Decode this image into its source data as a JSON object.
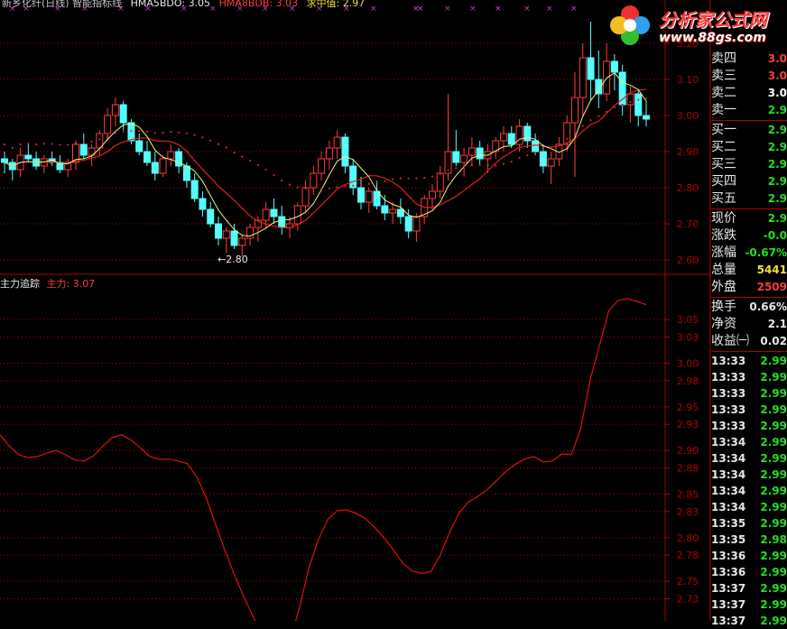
{
  "header": {
    "title": "新乡化纤(日线) 智能指标线",
    "ma1": "HMA5BDO: 3.05",
    "ma2": "HMA8BDB: 3.03",
    "ma3": "求中值: 2.97"
  },
  "indicator": {
    "name": "主力追踪",
    "value_label": "主力: 3.07"
  },
  "price_axis": [
    "3.20",
    "3.10",
    "3.00",
    "2.90",
    "2.80",
    "2.70",
    "2.60"
  ],
  "indicator_axis": [
    "3.05",
    "3.03",
    "3.00",
    "2.98",
    "2.95",
    "2.93",
    "2.90",
    "2.88",
    "2.85",
    "2.83",
    "2.80",
    "2.78",
    "2.75",
    "2.73"
  ],
  "low_marker": "←2.80",
  "quote": [
    {
      "label": "卖四",
      "value": "3.0",
      "color": "#ff3b3b"
    },
    {
      "label": "卖三",
      "value": "3.0",
      "color": "#ff3b3b"
    },
    {
      "label": "卖二",
      "value": "3.0",
      "color": "#ffffff"
    },
    {
      "label": "卖一",
      "value": "2.9",
      "color": "#20e020"
    },
    {
      "label": "买一",
      "value": "2.9",
      "color": "#20e020"
    },
    {
      "label": "买二",
      "value": "2.9",
      "color": "#20e020"
    },
    {
      "label": "买三",
      "value": "2.9",
      "color": "#20e020"
    },
    {
      "label": "买四",
      "value": "2.9",
      "color": "#20e020"
    },
    {
      "label": "买五",
      "value": "2.9",
      "color": "#20e020"
    },
    {
      "label": "现价",
      "value": "2.9",
      "color": "#20e020"
    },
    {
      "label": "涨跌",
      "value": "-0.0",
      "color": "#20e020"
    },
    {
      "label": "涨幅",
      "value": "-0.67%",
      "color": "#20e020"
    },
    {
      "label": "总量",
      "value": "5441",
      "color": "#f0e040"
    },
    {
      "label": "外盘",
      "value": "2509",
      "color": "#ff3b3b"
    },
    {
      "label": "换手",
      "value": "0.66%",
      "color": "#e8e8e8"
    },
    {
      "label": "净资",
      "value": "2.1",
      "color": "#e8e8e8"
    },
    {
      "label": "收益㈠",
      "value": "0.02",
      "color": "#e8e8e8"
    }
  ],
  "ticks": [
    {
      "time": "13:33",
      "price": "2.99"
    },
    {
      "time": "13:33",
      "price": "2.99"
    },
    {
      "time": "13:33",
      "price": "2.99"
    },
    {
      "time": "13:33",
      "price": "2.99"
    },
    {
      "time": "13:33",
      "price": "2.99"
    },
    {
      "time": "13:34",
      "price": "2.99"
    },
    {
      "time": "13:34",
      "price": "2.99"
    },
    {
      "time": "13:34",
      "price": "2.99"
    },
    {
      "time": "13:34",
      "price": "2.99"
    },
    {
      "time": "13:34",
      "price": "2.99"
    },
    {
      "time": "13:35",
      "price": "2.99"
    },
    {
      "time": "13:35",
      "price": "2.98"
    },
    {
      "time": "13:36",
      "price": "2.99"
    },
    {
      "time": "13:36",
      "price": "2.99"
    },
    {
      "time": "13:37",
      "price": "2.99"
    },
    {
      "time": "13:37",
      "price": "2.99"
    },
    {
      "time": "13:37",
      "price": "2.99"
    }
  ],
  "logo": {
    "name": "分析家公式网",
    "url_text": "www.88gs.com"
  },
  "colors": {
    "up": "#ff3b3b",
    "down": "#54ffff",
    "indicator_line": "#e01010",
    "grid": "#b00000",
    "ma_yellow": "#f0f080",
    "dotted": "#e02030"
  },
  "chart_data": {
    "type": "candlestick",
    "price_ylim": [
      2.57,
      3.25
    ],
    "indicator_ylim": [
      2.715,
      3.075
    ],
    "candles": [
      [
        2.88,
        2.9,
        2.84,
        2.87
      ],
      [
        2.87,
        2.88,
        2.82,
        2.85
      ],
      [
        2.85,
        2.91,
        2.83,
        2.89
      ],
      [
        2.89,
        2.92,
        2.87,
        2.88
      ],
      [
        2.88,
        2.9,
        2.85,
        2.86
      ],
      [
        2.86,
        2.89,
        2.84,
        2.88
      ],
      [
        2.88,
        2.9,
        2.86,
        2.87
      ],
      [
        2.87,
        2.89,
        2.84,
        2.85
      ],
      [
        2.85,
        2.88,
        2.83,
        2.87
      ],
      [
        2.87,
        2.93,
        2.85,
        2.92
      ],
      [
        2.92,
        2.95,
        2.88,
        2.89
      ],
      [
        2.89,
        2.92,
        2.86,
        2.91
      ],
      [
        2.91,
        2.96,
        2.89,
        2.95
      ],
      [
        2.95,
        3.02,
        2.93,
        3.0
      ],
      [
        3.0,
        3.05,
        2.97,
        3.03
      ],
      [
        3.03,
        3.04,
        2.96,
        2.98
      ],
      [
        2.98,
        2.99,
        2.92,
        2.93
      ],
      [
        2.93,
        2.95,
        2.89,
        2.9
      ],
      [
        2.9,
        2.93,
        2.86,
        2.87
      ],
      [
        2.87,
        2.9,
        2.82,
        2.84
      ],
      [
        2.84,
        2.89,
        2.83,
        2.88
      ],
      [
        2.88,
        2.92,
        2.86,
        2.9
      ],
      [
        2.9,
        2.91,
        2.84,
        2.86
      ],
      [
        2.86,
        2.87,
        2.8,
        2.82
      ],
      [
        2.82,
        2.84,
        2.76,
        2.77
      ],
      [
        2.77,
        2.79,
        2.72,
        2.74
      ],
      [
        2.74,
        2.76,
        2.69,
        2.7
      ],
      [
        2.7,
        2.72,
        2.64,
        2.66
      ],
      [
        2.66,
        2.69,
        2.62,
        2.68
      ],
      [
        2.68,
        2.7,
        2.63,
        2.64
      ],
      [
        2.64,
        2.67,
        2.61,
        2.66
      ],
      [
        2.66,
        2.7,
        2.64,
        2.69
      ],
      [
        2.69,
        2.72,
        2.65,
        2.71
      ],
      [
        2.71,
        2.76,
        2.69,
        2.74
      ],
      [
        2.74,
        2.77,
        2.7,
        2.72
      ],
      [
        2.72,
        2.75,
        2.67,
        2.69
      ],
      [
        2.69,
        2.72,
        2.66,
        2.7
      ],
      [
        2.7,
        2.76,
        2.68,
        2.75
      ],
      [
        2.75,
        2.82,
        2.73,
        2.8
      ],
      [
        2.8,
        2.86,
        2.78,
        2.84
      ],
      [
        2.84,
        2.9,
        2.82,
        2.88
      ],
      [
        2.88,
        2.93,
        2.85,
        2.91
      ],
      [
        2.91,
        2.96,
        2.88,
        2.94
      ],
      [
        2.94,
        2.95,
        2.84,
        2.86
      ],
      [
        2.86,
        2.88,
        2.78,
        2.8
      ],
      [
        2.8,
        2.83,
        2.74,
        2.76
      ],
      [
        2.76,
        2.8,
        2.73,
        2.79
      ],
      [
        2.79,
        2.82,
        2.74,
        2.75
      ],
      [
        2.75,
        2.78,
        2.71,
        2.73
      ],
      [
        2.73,
        2.76,
        2.7,
        2.74
      ],
      [
        2.74,
        2.77,
        2.7,
        2.72
      ],
      [
        2.72,
        2.74,
        2.66,
        2.68
      ],
      [
        2.68,
        2.73,
        2.65,
        2.72
      ],
      [
        2.72,
        2.78,
        2.7,
        2.77
      ],
      [
        2.77,
        2.81,
        2.74,
        2.79
      ],
      [
        2.79,
        2.86,
        2.77,
        2.84
      ],
      [
        2.84,
        3.06,
        2.82,
        2.9
      ],
      [
        2.9,
        2.96,
        2.86,
        2.87
      ],
      [
        2.87,
        2.91,
        2.83,
        2.89
      ],
      [
        2.89,
        2.94,
        2.86,
        2.91
      ],
      [
        2.91,
        2.93,
        2.86,
        2.88
      ],
      [
        2.88,
        2.92,
        2.84,
        2.9
      ],
      [
        2.9,
        2.94,
        2.88,
        2.93
      ],
      [
        2.93,
        2.97,
        2.9,
        2.95
      ],
      [
        2.95,
        2.97,
        2.91,
        2.92
      ],
      [
        2.92,
        2.99,
        2.9,
        2.97
      ],
      [
        2.97,
        2.98,
        2.91,
        2.93
      ],
      [
        2.93,
        2.95,
        2.89,
        2.9
      ],
      [
        2.9,
        2.92,
        2.84,
        2.86
      ],
      [
        2.86,
        2.9,
        2.81,
        2.88
      ],
      [
        2.88,
        2.94,
        2.86,
        2.92
      ],
      [
        2.92,
        3.0,
        2.9,
        2.98
      ],
      [
        2.98,
        3.12,
        2.83,
        3.05
      ],
      [
        3.05,
        3.2,
        3.0,
        3.16
      ],
      [
        3.16,
        3.26,
        3.04,
        3.1
      ],
      [
        3.1,
        3.18,
        3.02,
        3.06
      ],
      [
        3.06,
        3.2,
        3.04,
        3.15
      ],
      [
        3.15,
        3.17,
        3.07,
        3.12
      ],
      [
        3.12,
        3.14,
        3.0,
        3.03
      ],
      [
        3.03,
        3.08,
        2.98,
        3.06
      ],
      [
        3.06,
        3.07,
        2.97,
        3.0
      ],
      [
        3.0,
        3.04,
        2.97,
        2.99
      ]
    ],
    "indicator": [
      2.918,
      2.905,
      2.895,
      2.892,
      2.893,
      2.897,
      2.9,
      2.895,
      2.889,
      2.888,
      2.894,
      2.905,
      2.915,
      2.918,
      2.912,
      2.903,
      2.893,
      2.89,
      2.89,
      2.888,
      2.885,
      2.87,
      2.846,
      2.816,
      2.786,
      2.758,
      2.733,
      2.71,
      2.688,
      2.67,
      2.664,
      2.683,
      2.721,
      2.766,
      2.798,
      2.821,
      2.831,
      2.832,
      2.828,
      2.822,
      2.812,
      2.8,
      2.786,
      2.771,
      2.762,
      2.759,
      2.761,
      2.78,
      2.806,
      2.828,
      2.841,
      2.847,
      2.855,
      2.865,
      2.876,
      2.884,
      2.89,
      2.893,
      2.887,
      2.888,
      2.896,
      2.895,
      2.925,
      2.98,
      3.02,
      3.06,
      3.072,
      3.074,
      3.071,
      3.067
    ]
  }
}
